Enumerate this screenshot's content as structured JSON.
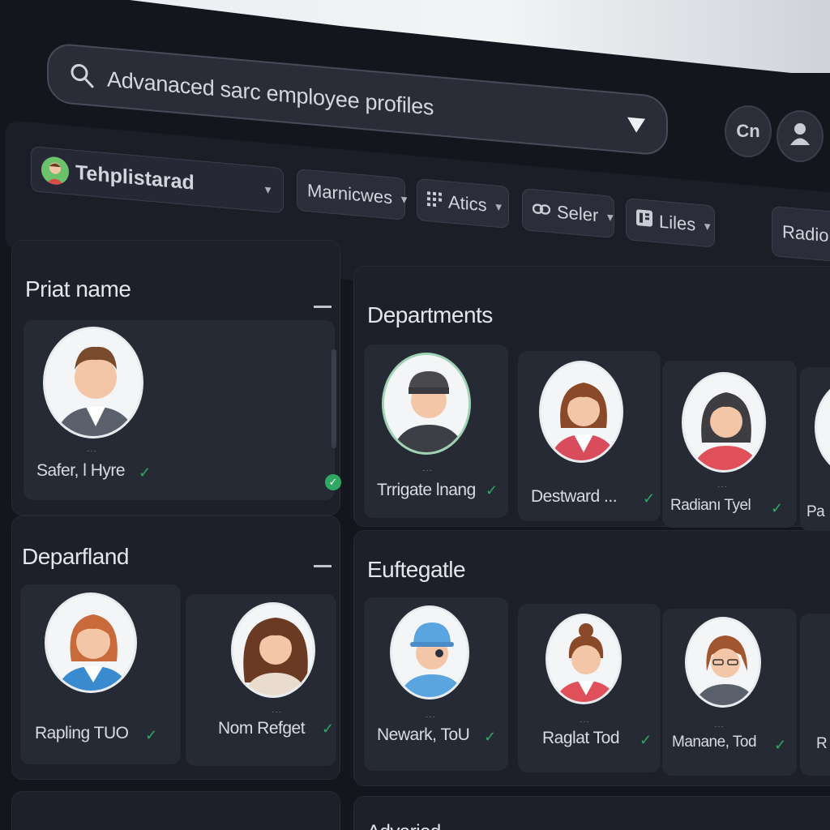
{
  "search": {
    "text": "Advanaced sarc employee profiles"
  },
  "header_buttons": [
    {
      "label": "Cn",
      "icon": "text-initials-icon"
    },
    {
      "label": "",
      "icon": "user-icon"
    }
  ],
  "toolbar": {
    "profile_select": "Tehplistarad",
    "filters": [
      {
        "label": "Marnicwes"
      },
      {
        "label": "Atics",
        "icon": "grid-icon"
      },
      {
        "label": "Seler",
        "icon": "link-icon"
      },
      {
        "label": "Liles",
        "icon": "list-icon"
      }
    ],
    "right_button": "Radio"
  },
  "panels": {
    "print_name": {
      "title": "Priat name",
      "people": [
        {
          "name": "Safer, l Hyre"
        }
      ]
    },
    "departments": {
      "title": "Departments",
      "people": [
        {
          "name": "Trrigate lnang"
        },
        {
          "name": "Destward ..."
        },
        {
          "name": "Radianı Tyel"
        },
        {
          "name": "Pa"
        }
      ]
    },
    "deparfland": {
      "title": "Deparfland",
      "people": [
        {
          "name": "Rapling TUO"
        },
        {
          "name": "Nom Refget"
        }
      ]
    },
    "euftegatle": {
      "title": "Euftegatle",
      "people": [
        {
          "name": "Newark, ToU"
        },
        {
          "name": "Raglat Tod"
        },
        {
          "name": "Manane, Tod"
        },
        {
          "name": "R"
        }
      ]
    },
    "bottom": {
      "title": "Advaried"
    }
  },
  "colors": {
    "background": "#14161d",
    "panel": "#1d2029",
    "card": "#262a35",
    "check": "#2fa864"
  }
}
